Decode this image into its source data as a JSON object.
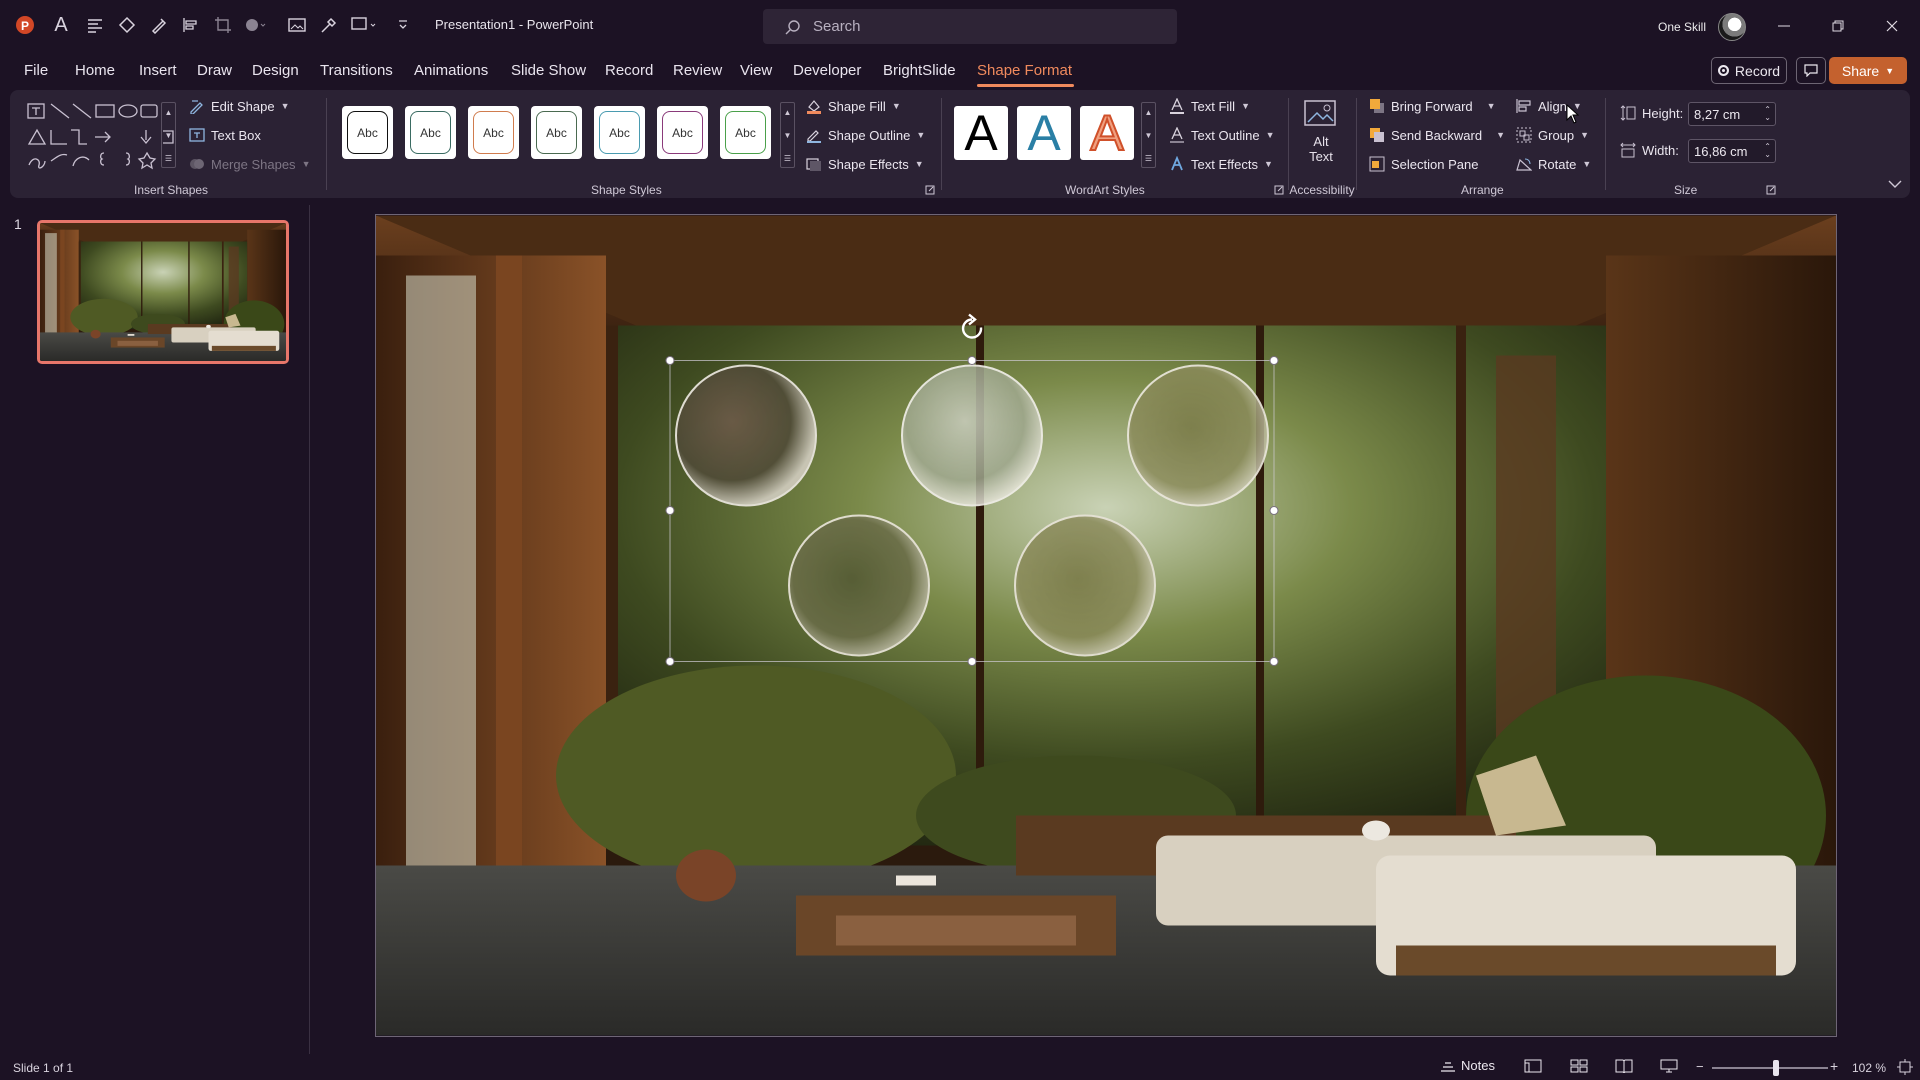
{
  "app": {
    "title": "Presentation1  -  PowerPoint",
    "search_placeholder": "Search",
    "user_name": "One Skill"
  },
  "tabs": [
    {
      "label": "File"
    },
    {
      "label": "Home"
    },
    {
      "label": "Insert"
    },
    {
      "label": "Draw"
    },
    {
      "label": "Design"
    },
    {
      "label": "Transitions"
    },
    {
      "label": "Animations"
    },
    {
      "label": "Slide Show"
    },
    {
      "label": "Record"
    },
    {
      "label": "Review"
    },
    {
      "label": "View"
    },
    {
      "label": "Developer"
    },
    {
      "label": "BrightSlide"
    },
    {
      "label": "Shape Format",
      "active": true
    }
  ],
  "header_actions": {
    "record_label": "Record",
    "share_label": "Share"
  },
  "ribbon": {
    "insert_shapes": {
      "label": "Insert Shapes",
      "edit_shape": "Edit Shape",
      "text_box": "Text Box",
      "merge_shapes": "Merge Shapes"
    },
    "shape_styles": {
      "label": "Shape Styles",
      "thumb_text": "Abc",
      "thumb_colors": [
        "#111111",
        "#3a6b62",
        "#d07c4e",
        "#4a6a50",
        "#4a9bb0",
        "#8a3a7a",
        "#4aa04a"
      ],
      "shape_fill": "Shape Fill",
      "shape_outline": "Shape Outline",
      "shape_effects": "Shape Effects"
    },
    "wordart_styles": {
      "label": "WordArt Styles",
      "letter": "A",
      "text_fill": "Text Fill",
      "text_outline": "Text Outline",
      "text_effects": "Text Effects"
    },
    "accessibility": {
      "label": "Accessibility",
      "alt_text_line1": "Alt",
      "alt_text_line2": "Text"
    },
    "arrange": {
      "label": "Arrange",
      "bring_forward": "Bring Forward",
      "send_backward": "Send Backward",
      "selection_pane": "Selection Pane",
      "align": "Align",
      "group": "Group",
      "rotate": "Rotate"
    },
    "size": {
      "label": "Size",
      "height_label": "Height:",
      "height_value": "8,27 cm",
      "width_label": "Width:",
      "width_value": "16,86 cm"
    }
  },
  "slides_panel": {
    "slide_number": "1"
  },
  "status": {
    "slide_info": "Slide 1 of 1",
    "notes_label": "Notes",
    "zoom_level": "102 %",
    "zoom_fraction": 0.55
  },
  "colors": {
    "accent": "#f08a5d",
    "share": "#c4612e",
    "thumb_border": "#e7766a",
    "background": "#1c1224",
    "ribbon": "#2b2234"
  }
}
